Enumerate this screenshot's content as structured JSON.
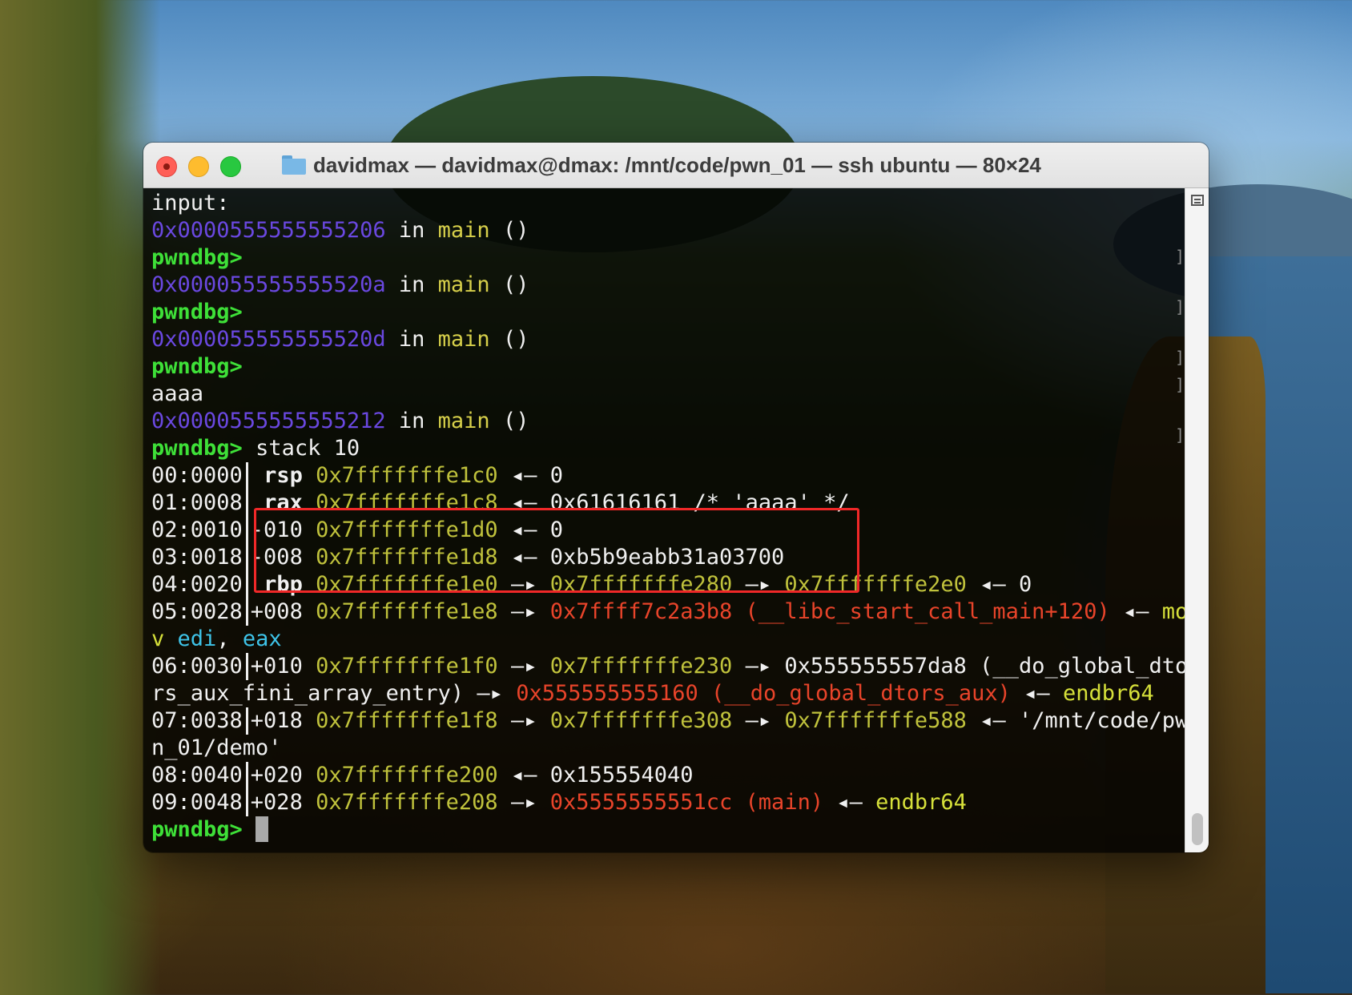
{
  "window": {
    "title": "davidmax — davidmax@dmax: /mnt/code/pwn_01 — ssh ubuntu — 80×24"
  },
  "terminal": {
    "input_label": "input:",
    "prompt": "pwndbg>",
    "frames": [
      {
        "addr": "0x0000555555555206",
        "in": "in",
        "func": "main",
        "args": "()"
      },
      {
        "addr": "0x000055555555520a",
        "in": "in",
        "func": "main",
        "args": "()"
      },
      {
        "addr": "0x000055555555520d",
        "in": "in",
        "func": "main",
        "args": "()"
      },
      {
        "addr": "0x0000555555555212",
        "in": "in",
        "func": "main",
        "args": "()"
      }
    ],
    "user_input": "aaaa",
    "command": "stack 10",
    "stack": [
      {
        "idx": "00:0000",
        "reg": "rsp",
        "addr": "0x7fffffffe1c0",
        "arrow": "◂—",
        "val": "0"
      },
      {
        "idx": "01:0008",
        "reg": "rax",
        "addr": "0x7fffffffe1c8",
        "arrow": "◂—",
        "val": "0x61616161 /* 'aaaa' */"
      },
      {
        "idx": "02:0010",
        "reg": "-010",
        "addr": "0x7fffffffe1d0",
        "arrow": "◂—",
        "val": "0"
      },
      {
        "idx": "03:0018",
        "reg": "-008",
        "addr": "0x7fffffffe1d8",
        "arrow": "◂—",
        "val": "0xb5b9eabb31a03700"
      },
      {
        "idx": "04:0020",
        "reg": "rbp",
        "addr": "0x7fffffffe1e0",
        "arrow": "—▸",
        "p1": "0x7fffffffe280",
        "arrow2": "—▸",
        "p2": "0x7fffffffe2e0",
        "arrow3": "◂—",
        "val": "0"
      },
      {
        "idx": "05:0028",
        "reg": "+008",
        "addr": "0x7fffffffe1e8",
        "arrow": "—▸",
        "p1": "0x7ffff7c2a3b8 (__libc_start_call_main+120)",
        "arrow2": "◂—",
        "ins_a": "mo",
        "ins_b": "v",
        "op1": "edi",
        "comma": ",",
        "op2": "eax"
      },
      {
        "idx": "06:0030",
        "reg": "+010",
        "addr": "0x7fffffffe1f0",
        "arrow": "—▸",
        "p1": "0x7fffffffe230",
        "arrow2": "—▸",
        "p2a": "0x555555557da8 (__do_global_dto",
        "p2b": "rs_aux_fini_array_entry)",
        "arrow3": "—▸",
        "p3": "0x555555555160 (__do_global_dtors_aux)",
        "arrow4": "◂—",
        "ins": "endbr64"
      },
      {
        "idx": "07:0038",
        "reg": "+018",
        "addr": "0x7fffffffe1f8",
        "arrow": "—▸",
        "p1": "0x7fffffffe308",
        "arrow2": "—▸",
        "p2": "0x7fffffffe588",
        "arrow3": "◂—",
        "str_a": "'/mnt/code/pw",
        "str_b": "n_01/demo'"
      },
      {
        "idx": "08:0040",
        "reg": "+020",
        "addr": "0x7fffffffe200",
        "arrow": "◂—",
        "val": "0x155554040"
      },
      {
        "idx": "09:0048",
        "reg": "+028",
        "addr": "0x7fffffffe208",
        "arrow": "—▸",
        "p1": "0x5555555551cc (main)",
        "arrow2": "◂—",
        "ins": "endbr64"
      }
    ]
  }
}
